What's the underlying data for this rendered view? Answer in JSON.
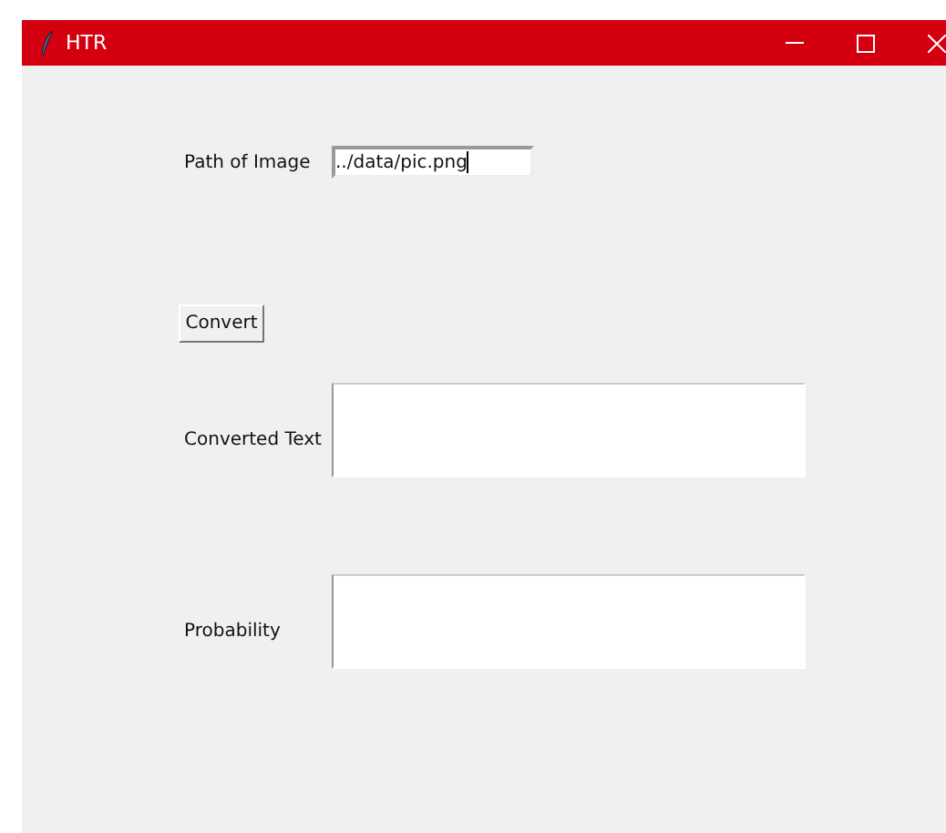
{
  "window": {
    "title": "HTR"
  },
  "path_of_image": {
    "label": "Path of Image",
    "value": "../data/pic.png",
    "focused": true
  },
  "convert_button": {
    "label": "Convert"
  },
  "converted_text": {
    "label": "Converted Text"
  },
  "probability": {
    "label": "Probability"
  }
}
